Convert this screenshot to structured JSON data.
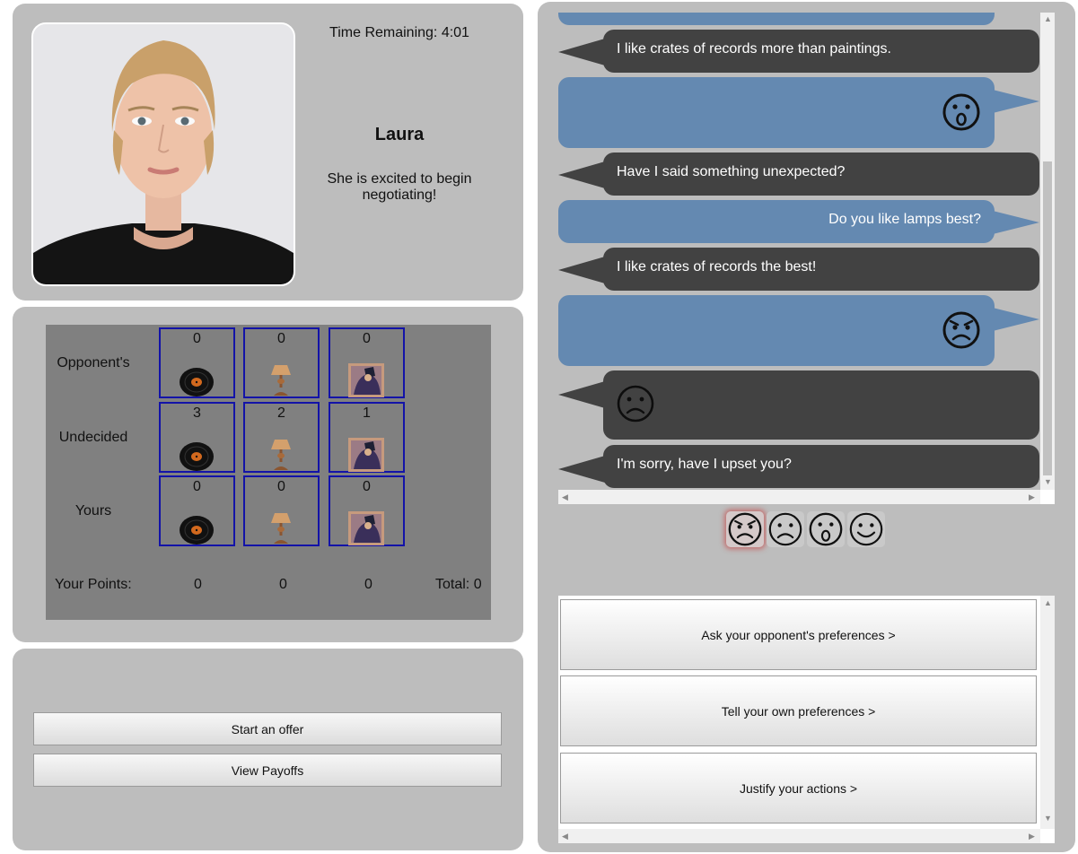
{
  "agent": {
    "time_label": "Time Remaining: 4:01",
    "name": "Laura",
    "status": "She is excited to begin negotiating!"
  },
  "board": {
    "rows": [
      {
        "label": "Opponent's",
        "values": [
          "0",
          "0",
          "0"
        ]
      },
      {
        "label": "Undecided",
        "values": [
          "3",
          "2",
          "1"
        ]
      },
      {
        "label": "Yours",
        "values": [
          "0",
          "0",
          "0"
        ]
      }
    ],
    "items": [
      "record-crate-icon",
      "lamp-icon",
      "painting-icon"
    ],
    "points_label": "Your Points:",
    "points": [
      "0",
      "0",
      "0"
    ],
    "total_label": "Total: 0"
  },
  "actions": {
    "start_offer": "Start an offer",
    "view_payoffs": "View Payoffs"
  },
  "chat": {
    "messages": [
      {
        "from": "agent",
        "text": "I like crates of records more than paintings."
      },
      {
        "from": "user",
        "emoji": "surprised-face-icon"
      },
      {
        "from": "agent",
        "text": "Have I said something unexpected?"
      },
      {
        "from": "user",
        "text": "Do you like lamps best?"
      },
      {
        "from": "agent",
        "text": "I like crates of records the best!"
      },
      {
        "from": "user",
        "emoji": "angry-face-icon"
      },
      {
        "from": "agent",
        "emoji": "sad-face-icon"
      },
      {
        "from": "agent",
        "text": "I'm sorry, have I upset you?"
      }
    ]
  },
  "emotions": [
    "angry",
    "sad",
    "surprised",
    "happy"
  ],
  "emotion_selected": "angry",
  "menu": {
    "ask": "Ask your opponent's preferences >",
    "tell": "Tell your own preferences >",
    "justify": "Justify your actions >"
  },
  "colors": {
    "panel": "#bdbdbd",
    "board": "#808080",
    "cell_border": "#1313a8",
    "agent_bubble": "#424242",
    "user_bubble": "#6489b1"
  }
}
